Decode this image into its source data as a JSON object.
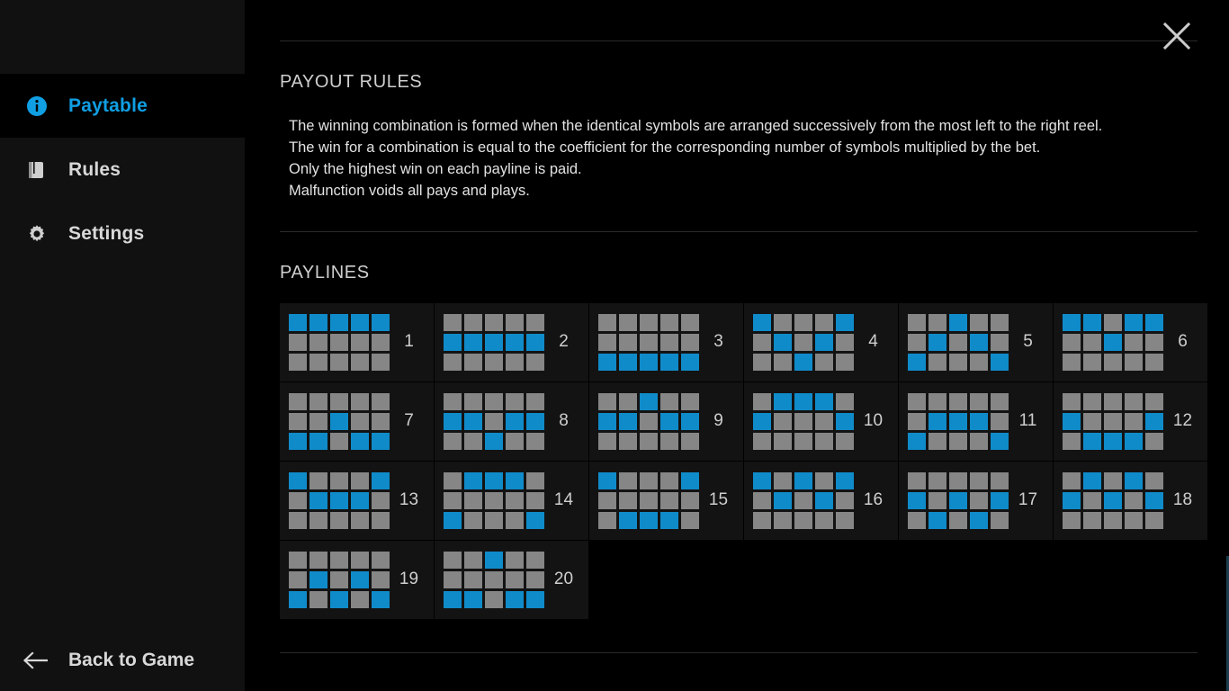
{
  "sidebar": {
    "items": [
      {
        "label": "Paytable",
        "icon": "info-circle-icon",
        "active": true
      },
      {
        "label": "Rules",
        "icon": "book-icon",
        "active": false
      },
      {
        "label": "Settings",
        "icon": "gear-icon",
        "active": false
      }
    ],
    "back": {
      "label": "Back to Game",
      "icon": "arrow-left-icon"
    }
  },
  "header": {
    "close_icon": "close-icon"
  },
  "payout_rules": {
    "title": "PAYOUT RULES",
    "lines": [
      "The winning combination is formed when the identical symbols are arranged successively from the most left to the right reel.",
      "The win for a combination is equal to the coefficient for the corresponding number of symbols multiplied by the bet.",
      "Only the highest win on each payline is paid.",
      "Malfunction voids all pays and plays."
    ]
  },
  "paylines_section": {
    "title": "PAYLINES",
    "reels": 5,
    "rows": 3,
    "active_color": "#108bc9",
    "inactive_color": "#868686",
    "lines": [
      {
        "number": "1",
        "pattern": [
          0,
          0,
          0,
          0,
          0
        ]
      },
      {
        "number": "2",
        "pattern": [
          1,
          1,
          1,
          1,
          1
        ]
      },
      {
        "number": "3",
        "pattern": [
          2,
          2,
          2,
          2,
          2
        ]
      },
      {
        "number": "4",
        "pattern": [
          0,
          1,
          2,
          1,
          0
        ]
      },
      {
        "number": "5",
        "pattern": [
          2,
          1,
          0,
          1,
          2
        ]
      },
      {
        "number": "6",
        "pattern": [
          0,
          0,
          1,
          0,
          0
        ]
      },
      {
        "number": "7",
        "pattern": [
          2,
          2,
          1,
          2,
          2
        ]
      },
      {
        "number": "8",
        "pattern": [
          1,
          1,
          2,
          1,
          1
        ]
      },
      {
        "number": "9",
        "pattern": [
          1,
          1,
          0,
          1,
          1
        ]
      },
      {
        "number": "10",
        "pattern": [
          1,
          0,
          0,
          0,
          1
        ]
      },
      {
        "number": "11",
        "pattern": [
          2,
          1,
          1,
          1,
          2
        ]
      },
      {
        "number": "12",
        "pattern": [
          1,
          2,
          2,
          2,
          1
        ]
      },
      {
        "number": "13",
        "pattern": [
          0,
          1,
          1,
          1,
          0
        ]
      },
      {
        "number": "14",
        "pattern": [
          2,
          0,
          0,
          0,
          2
        ]
      },
      {
        "number": "15",
        "pattern": [
          0,
          2,
          2,
          2,
          0
        ]
      },
      {
        "number": "16",
        "pattern": [
          0,
          1,
          0,
          1,
          0
        ]
      },
      {
        "number": "17",
        "pattern": [
          1,
          2,
          1,
          2,
          1
        ]
      },
      {
        "number": "18",
        "pattern": [
          1,
          0,
          1,
          0,
          1
        ]
      },
      {
        "number": "19",
        "pattern": [
          2,
          1,
          2,
          1,
          2
        ]
      },
      {
        "number": "20",
        "pattern": [
          2,
          2,
          0,
          2,
          2
        ]
      }
    ]
  }
}
